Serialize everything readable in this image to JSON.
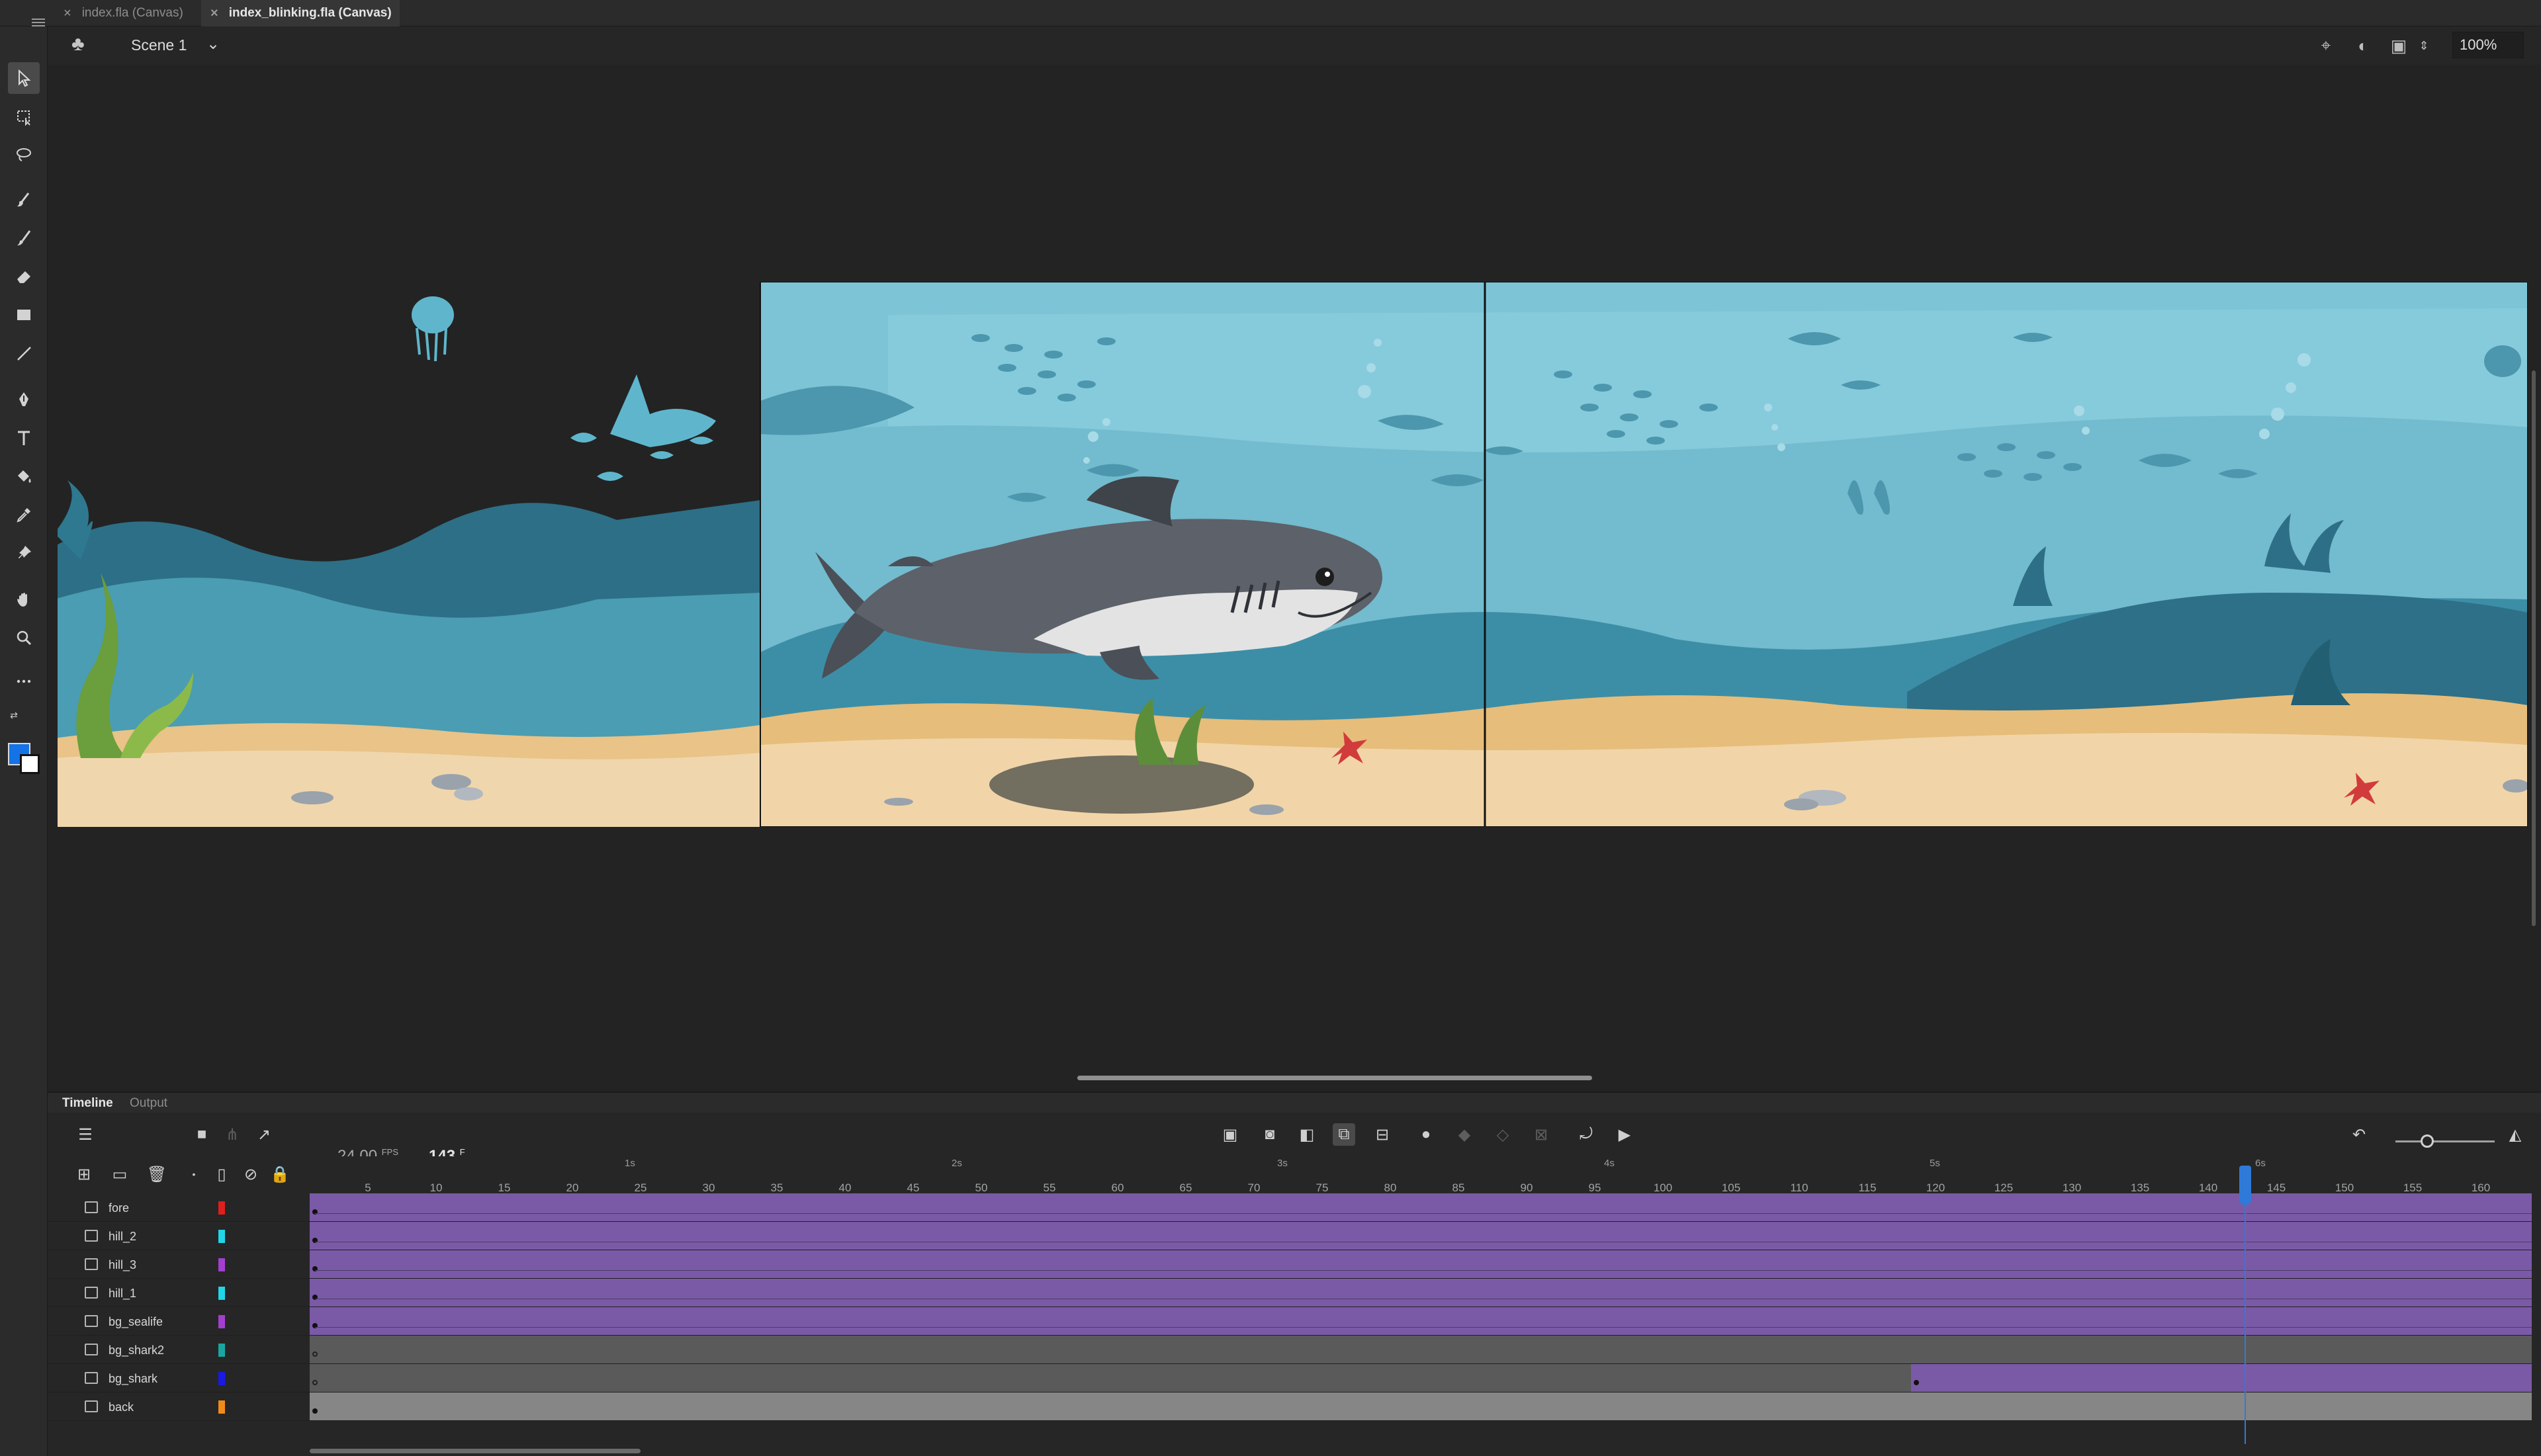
{
  "tabs": [
    {
      "label": "index.fla (Canvas)",
      "active": false
    },
    {
      "label": "index_blinking.fla (Canvas)",
      "active": true
    }
  ],
  "scene": {
    "name": "Scene 1"
  },
  "zoom": "100%",
  "colors": {
    "fill": "#1473e6",
    "stroke": "#ffffff",
    "accent": "#2f7ad9",
    "span_purple": "#7a5aa6"
  },
  "tools": [
    "selection-tool-icon",
    "free-transform-icon",
    "lasso-icon",
    "paint-brush-icon",
    "brush-icon",
    "eraser-icon",
    "rectangle-icon",
    "line-icon",
    "pen-icon",
    "text-icon",
    "paint-bucket-icon",
    "eyedropper-icon",
    "pin-icon",
    "hand-icon",
    "zoom-icon",
    "more-icon"
  ],
  "timeline": {
    "tabs": {
      "timeline": "Timeline",
      "output": "Output"
    },
    "fps": "24.00",
    "fps_unit": "FPS",
    "current_frame": "143",
    "frame_unit": "F",
    "seconds": [
      "1s",
      "2s",
      "3s",
      "4s",
      "5s",
      "6s"
    ],
    "ticks": [
      "5",
      "10",
      "15",
      "20",
      "25",
      "30",
      "35",
      "40",
      "45",
      "50",
      "55",
      "60",
      "65",
      "70",
      "75",
      "80",
      "85",
      "90",
      "95",
      "100",
      "105",
      "110",
      "115",
      "120",
      "125",
      "130",
      "135",
      "140",
      "145",
      "150",
      "155",
      "160"
    ],
    "layers": [
      {
        "name": "fore",
        "color": "#e01e1e"
      },
      {
        "name": "hill_2",
        "color": "#20d6e6"
      },
      {
        "name": "hill_3",
        "color": "#a23fcf"
      },
      {
        "name": "hill_1",
        "color": "#20d6e6"
      },
      {
        "name": "bg_sealife",
        "color": "#a23fcf"
      },
      {
        "name": "bg_shark2",
        "color": "#1aa6a0"
      },
      {
        "name": "bg_shark",
        "color": "#1a1ae6"
      },
      {
        "name": "back",
        "color": "#f08a1a"
      }
    ]
  }
}
